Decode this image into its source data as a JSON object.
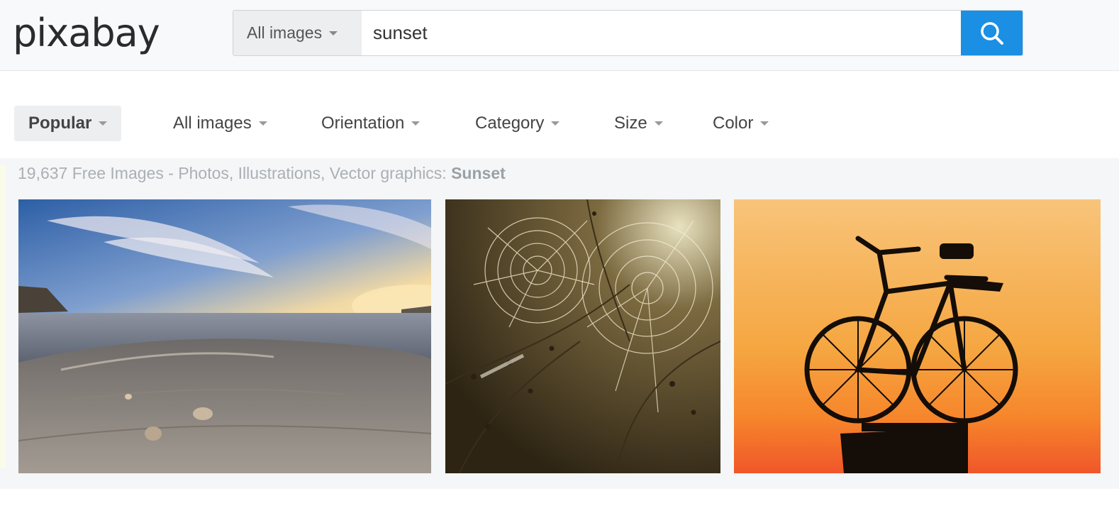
{
  "header": {
    "logo": "pixabay",
    "search": {
      "type_label": "All images",
      "value": "sunset"
    }
  },
  "filters": [
    {
      "label": "Popular",
      "active": true
    },
    {
      "label": "All images"
    },
    {
      "label": "Orientation"
    },
    {
      "label": "Category"
    },
    {
      "label": "Size"
    },
    {
      "label": "Color"
    }
  ],
  "results": {
    "title_prefix": "19,637 Free Images - Photos, Illustrations, Vector graphics:",
    "title_query": "Sunset",
    "images": [
      {
        "subject": "rocky coastline at sunset"
      },
      {
        "subject": "spider webs with dew"
      },
      {
        "subject": "bicycle silhouette at sunset"
      }
    ]
  },
  "colors": {
    "accent": "#1a8fe3",
    "header_bg": "#f8f9fa",
    "results_bg": "#f4f6f8"
  }
}
